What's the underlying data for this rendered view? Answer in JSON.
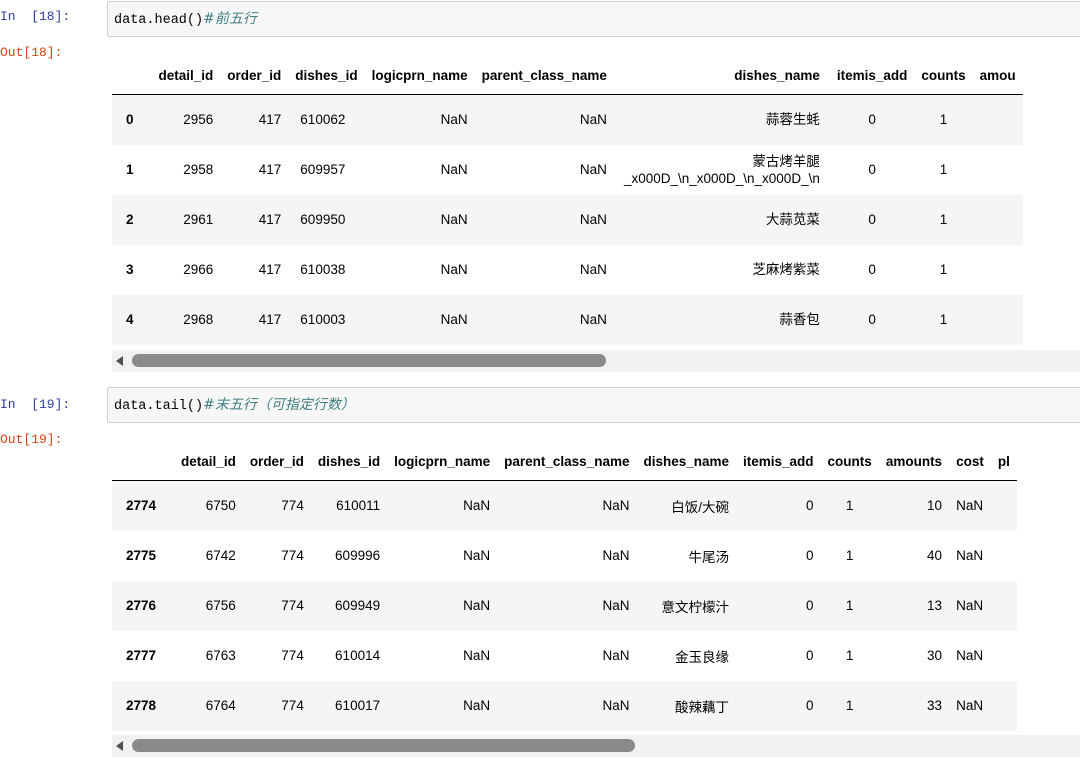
{
  "cells": [
    {
      "in_prompt": "In  [18]:",
      "code": "data.head()",
      "comment": "#前五行",
      "out_prompt": "Out[18]:",
      "table": {
        "columns": [
          "detail_id",
          "order_id",
          "dishes_id",
          "logicprn_name",
          "parent_class_name",
          "dishes_name",
          "itemis_add",
          "counts",
          "amou"
        ],
        "rows": [
          {
            "index": "0",
            "cells": [
              "2956",
              "417",
              "610062",
              "NaN",
              "NaN",
              "蒜蓉生蚝",
              "0",
              "1",
              ""
            ]
          },
          {
            "index": "1",
            "cells": [
              "2958",
              "417",
              "609957",
              "NaN",
              "NaN",
              "蒙古烤羊腿\n_x000D_\\n_x000D_\\n_x000D_\\n",
              "0",
              "1",
              ""
            ]
          },
          {
            "index": "2",
            "cells": [
              "2961",
              "417",
              "609950",
              "NaN",
              "NaN",
              "大蒜苋菜",
              "0",
              "1",
              ""
            ]
          },
          {
            "index": "3",
            "cells": [
              "2966",
              "417",
              "610038",
              "NaN",
              "NaN",
              "芝麻烤紫菜",
              "0",
              "1",
              ""
            ]
          },
          {
            "index": "4",
            "cells": [
              "2968",
              "417",
              "610003",
              "NaN",
              "NaN",
              "蒜香包",
              "0",
              "1",
              ""
            ]
          }
        ]
      }
    },
    {
      "in_prompt": "In  [19]:",
      "code": "data.tail()",
      "comment": "#末五行（可指定行数）",
      "out_prompt": "Out[19]:",
      "table": {
        "columns": [
          "detail_id",
          "order_id",
          "dishes_id",
          "logicprn_name",
          "parent_class_name",
          "dishes_name",
          "itemis_add",
          "counts",
          "amounts",
          "cost",
          "pl"
        ],
        "rows": [
          {
            "index": "2774",
            "cells": [
              "6750",
              "774",
              "610011",
              "NaN",
              "NaN",
              "白饭/大碗",
              "0",
              "1",
              "10",
              "NaN",
              ""
            ]
          },
          {
            "index": "2775",
            "cells": [
              "6742",
              "774",
              "609996",
              "NaN",
              "NaN",
              "牛尾汤",
              "0",
              "1",
              "40",
              "NaN",
              ""
            ]
          },
          {
            "index": "2776",
            "cells": [
              "6756",
              "774",
              "609949",
              "NaN",
              "NaN",
              "意文柠檬汁",
              "0",
              "1",
              "13",
              "NaN",
              ""
            ]
          },
          {
            "index": "2777",
            "cells": [
              "6763",
              "774",
              "610014",
              "NaN",
              "NaN",
              "金玉良缘",
              "0",
              "1",
              "30",
              "NaN",
              ""
            ]
          },
          {
            "index": "2778",
            "cells": [
              "6764",
              "774",
              "610017",
              "NaN",
              "NaN",
              "酸辣藕丁",
              "0",
              "1",
              "33",
              "NaN",
              ""
            ]
          }
        ]
      }
    }
  ],
  "scrollbars": [
    {
      "icon": "scroll-left-arrow-icon",
      "thumb_fraction": 0.49
    },
    {
      "icon": "scroll-left-arrow-icon",
      "thumb_fraction": 0.52
    }
  ]
}
